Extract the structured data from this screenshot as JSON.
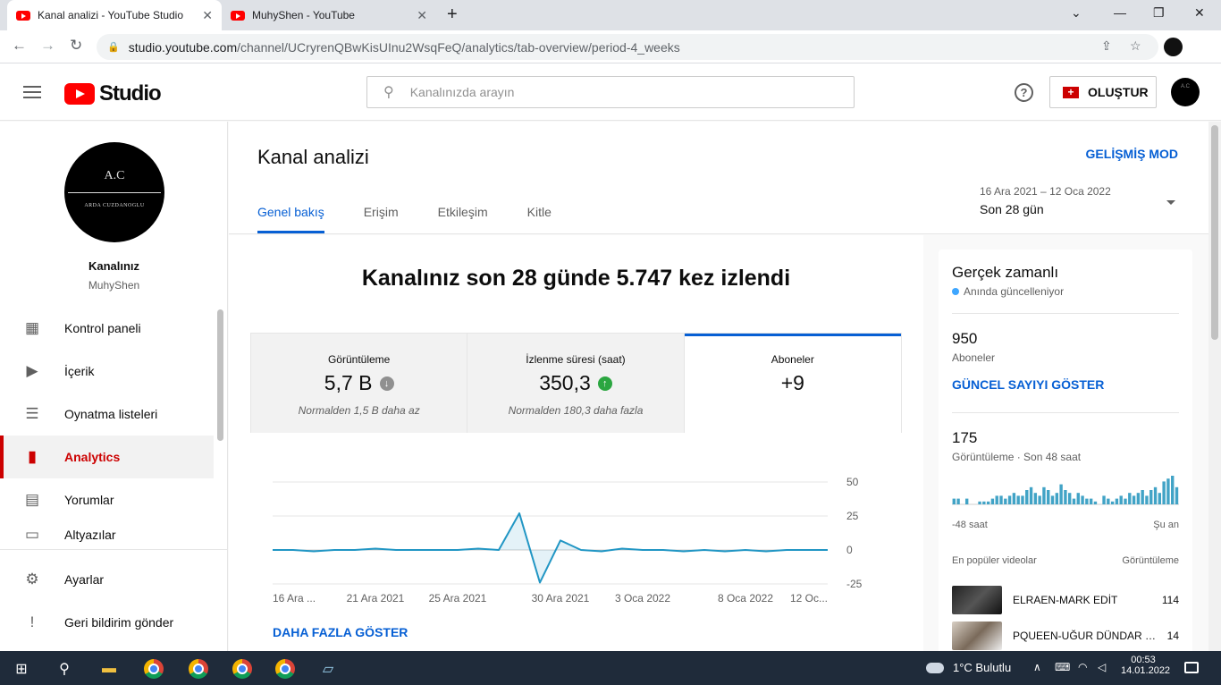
{
  "browser": {
    "tabs": [
      {
        "title": "Kanal analizi - YouTube Studio",
        "active": true
      },
      {
        "title": "MuhyShen - YouTube",
        "active": false
      }
    ],
    "url_host": "studio.youtube.com",
    "url_path": "/channel/UCryrenQBwKisUInu2WsqFeQ/analytics/tab-overview/period-4_weeks"
  },
  "header": {
    "logo_text": "Studio",
    "search_placeholder": "Kanalınızda arayın",
    "create_label": "OLUŞTUR"
  },
  "sidebar": {
    "channel_avatar_initials": "A.C",
    "channel_avatar_name": "ARDA CUZDANOGLU",
    "channel_label": "Kanalınız",
    "channel_name": "MuhyShen",
    "items": [
      {
        "label": "Kontrol paneli",
        "icon": "dashboard-icon",
        "active": false
      },
      {
        "label": "İçerik",
        "icon": "content-icon",
        "active": false
      },
      {
        "label": "Oynatma listeleri",
        "icon": "playlist-icon",
        "active": false
      },
      {
        "label": "Analytics",
        "icon": "analytics-icon",
        "active": true
      },
      {
        "label": "Yorumlar",
        "icon": "comments-icon",
        "active": false
      },
      {
        "label": "Altyazılar",
        "icon": "subtitles-icon",
        "active": false
      }
    ],
    "bottom_items": [
      {
        "label": "Ayarlar",
        "icon": "gear-icon"
      },
      {
        "label": "Geri bildirim gönder",
        "icon": "feedback-icon"
      }
    ]
  },
  "main": {
    "title": "Kanal analizi",
    "advanced_mode": "GELİŞMİŞ MOD",
    "tabs": [
      {
        "label": "Genel bakış",
        "active": true
      },
      {
        "label": "Erişim",
        "active": false
      },
      {
        "label": "Etkileşim",
        "active": false
      },
      {
        "label": "Kitle",
        "active": false
      }
    ],
    "date_range": "16 Ara 2021 – 12 Oca 2022",
    "date_label": "Son 28 gün",
    "headline": "Kanalınız son 28 günde 5.747 kez izlendi",
    "metrics": [
      {
        "label": "Görüntüleme",
        "value": "5,7 B",
        "trend": "down",
        "note": "Normalden 1,5 B daha az"
      },
      {
        "label": "İzlenme süresi (saat)",
        "value": "350,3",
        "trend": "up",
        "note": "Normalden 180,3 daha fazla"
      },
      {
        "label": "Aboneler",
        "value": "+9",
        "trend": "none",
        "note": ""
      }
    ],
    "show_more": "DAHA FAZLA GÖSTER"
  },
  "chart_data": {
    "type": "line",
    "x": [
      "16 Ara 2021",
      "17 Ara 2021",
      "18 Ara 2021",
      "19 Ara 2021",
      "20 Ara 2021",
      "21 Ara 2021",
      "22 Ara 2021",
      "23 Ara 2021",
      "24 Ara 2021",
      "25 Ara 2021",
      "26 Ara 2021",
      "27 Ara 2021",
      "28 Ara 2021",
      "29 Ara 2021",
      "30 Ara 2021",
      "31 Ara 2021",
      "1 Oca 2022",
      "2 Oca 2022",
      "3 Oca 2022",
      "4 Oca 2022",
      "5 Oca 2022",
      "6 Oca 2022",
      "7 Oca 2022",
      "8 Oca 2022",
      "9 Oca 2022",
      "10 Oca 2022",
      "11 Oca 2022",
      "12 Oca 2022"
    ],
    "values": [
      0,
      0,
      -1,
      0,
      0,
      1,
      0,
      0,
      0,
      0,
      1,
      0,
      27,
      -24,
      7,
      0,
      -1,
      1,
      0,
      0,
      -1,
      0,
      -1,
      0,
      -1,
      0,
      0,
      0
    ],
    "tick_labels": [
      "16 Ara ...",
      "21 Ara 2021",
      "25 Ara 2021",
      "30 Ara 2021",
      "3 Oca 2022",
      "8 Oca 2022",
      "12 Oc..."
    ],
    "tick_indices": [
      0,
      5,
      9,
      14,
      18,
      23,
      27
    ],
    "y_ticks": [
      50,
      25,
      0,
      -25
    ],
    "ylim": [
      -25,
      50
    ],
    "color": "#2196c4"
  },
  "realtime": {
    "title": "Gerçek zamanlı",
    "subtitle": "Anında güncelleniyor",
    "subscribers_value": "950",
    "subscribers_label": "Aboneler",
    "show_count": "GÜNCEL SAYIYI GÖSTER",
    "views_value": "175",
    "views_label": "Görüntüleme · Son 48 saat",
    "axis_left": "-48 saat",
    "axis_right": "Şu an",
    "bars": [
      2,
      2,
      0,
      2,
      0,
      0,
      1,
      1,
      1,
      2,
      3,
      3,
      2,
      3,
      4,
      3,
      3,
      5,
      6,
      4,
      3,
      6,
      5,
      3,
      4,
      7,
      5,
      4,
      2,
      4,
      3,
      2,
      2,
      1,
      0,
      3,
      2,
      1,
      2,
      3,
      2,
      4,
      3,
      4,
      5,
      3,
      5,
      6,
      4,
      8,
      9,
      10,
      6
    ],
    "list_header_left": "En popüler videolar",
    "list_header_right": "Görüntüleme",
    "videos": [
      {
        "title": "ELRAEN-MARK EDİT",
        "views": "114"
      },
      {
        "title": "PQUEEN-UĞUR DÜNDAR EDİT",
        "views": "14"
      }
    ]
  },
  "taskbar": {
    "weather": "1°C  Bulutlu",
    "time": "00:53",
    "date": "14.01.2022"
  }
}
